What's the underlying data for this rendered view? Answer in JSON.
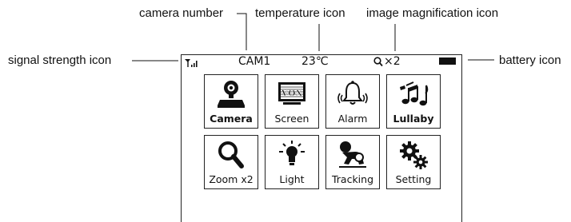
{
  "callouts": {
    "camera_number": "camera number",
    "temperature_icon": "temperature icon",
    "image_magnification_icon": "image magnification icon",
    "signal_strength_icon": "signal strength icon",
    "battery_icon": "battery icon"
  },
  "status_bar": {
    "camera": "CAM1",
    "temperature": "23℃",
    "zoom": "×2"
  },
  "menu": {
    "items": [
      {
        "label": "Camera",
        "icon": "camera-icon"
      },
      {
        "label": "Screen",
        "icon": "vox-screen-icon",
        "badge": "VOX"
      },
      {
        "label": "Alarm",
        "icon": "bell-icon"
      },
      {
        "label": "Lullaby",
        "icon": "music-notes-icon"
      },
      {
        "label": "Zoom x2",
        "icon": "magnifier-icon"
      },
      {
        "label": "Light",
        "icon": "light-bulb-icon"
      },
      {
        "label": "Tracking",
        "icon": "baby-crawling-icon"
      },
      {
        "label": "Setting",
        "icon": "gears-icon"
      }
    ]
  }
}
